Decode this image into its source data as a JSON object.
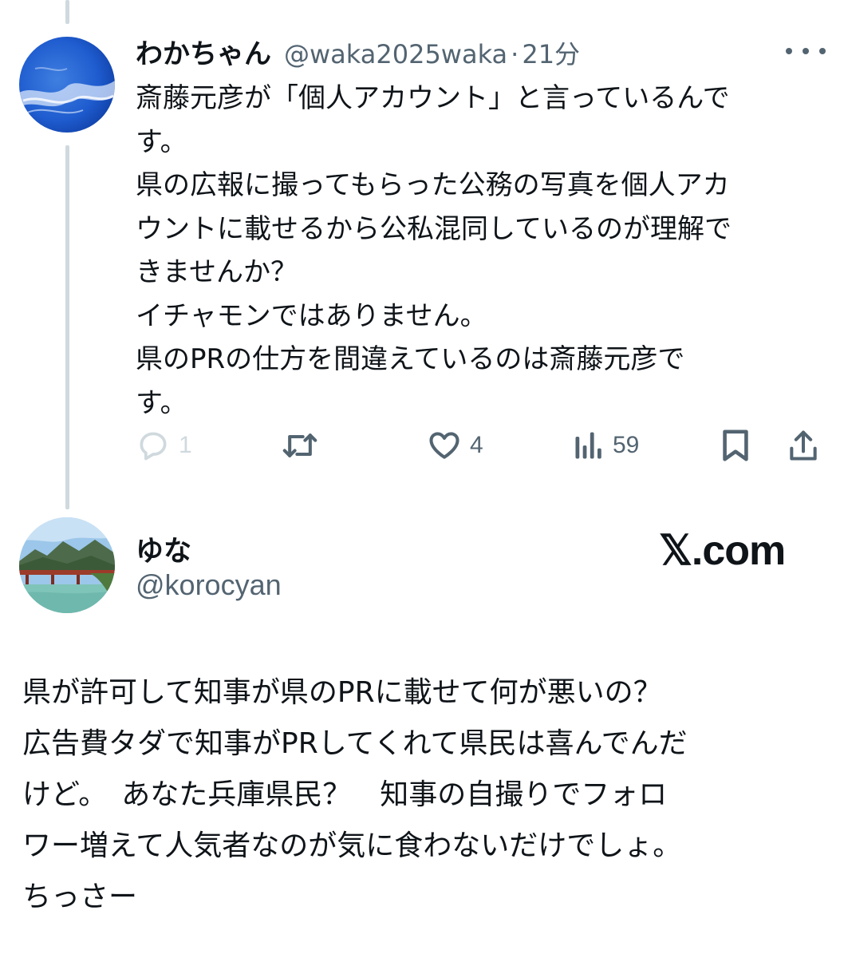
{
  "tweet": {
    "display_name": "わかちゃん",
    "handle": "@waka2025waka",
    "separator": "·",
    "time": "21分",
    "body_lines": [
      "斎藤元彦が「個人アカウント」と言っているんで",
      "す。",
      "県の広報に撮ってもらった公務の写真を個人アカ",
      "ウントに載せるから公私混同しているのが理解で",
      "きませんか？",
      "イチャモンではありません。",
      "県のPRの仕方を間違えているのは斎藤元彦で",
      "す。"
    ],
    "actions": {
      "reply_count": "1",
      "repost_count": "",
      "like_count": "4",
      "views_count": "59"
    },
    "icons": [
      "more-icon",
      "reply-icon",
      "repost-icon",
      "like-icon",
      "views-icon",
      "bookmark-icon",
      "share-icon"
    ]
  },
  "quoted": {
    "display_name": "ゆな",
    "handle": "@korocyan",
    "watermark": "𝕏.com",
    "body_lines": [
      "県が許可して知事が県のPRに載せて何が悪いの？",
      "広告費タダで知事がPRしてくれて県民は喜んでんだ",
      "けど。　あなた兵庫県民？　知事の自撮りでフォロ",
      "ワー増えて人気者なのが気に食わないだけでしょ。",
      "ちっさー"
    ]
  },
  "colors": {
    "text": "#0f1419",
    "secondary": "#536471",
    "thread_line": "#cfd9de",
    "background": "#ffffff"
  }
}
